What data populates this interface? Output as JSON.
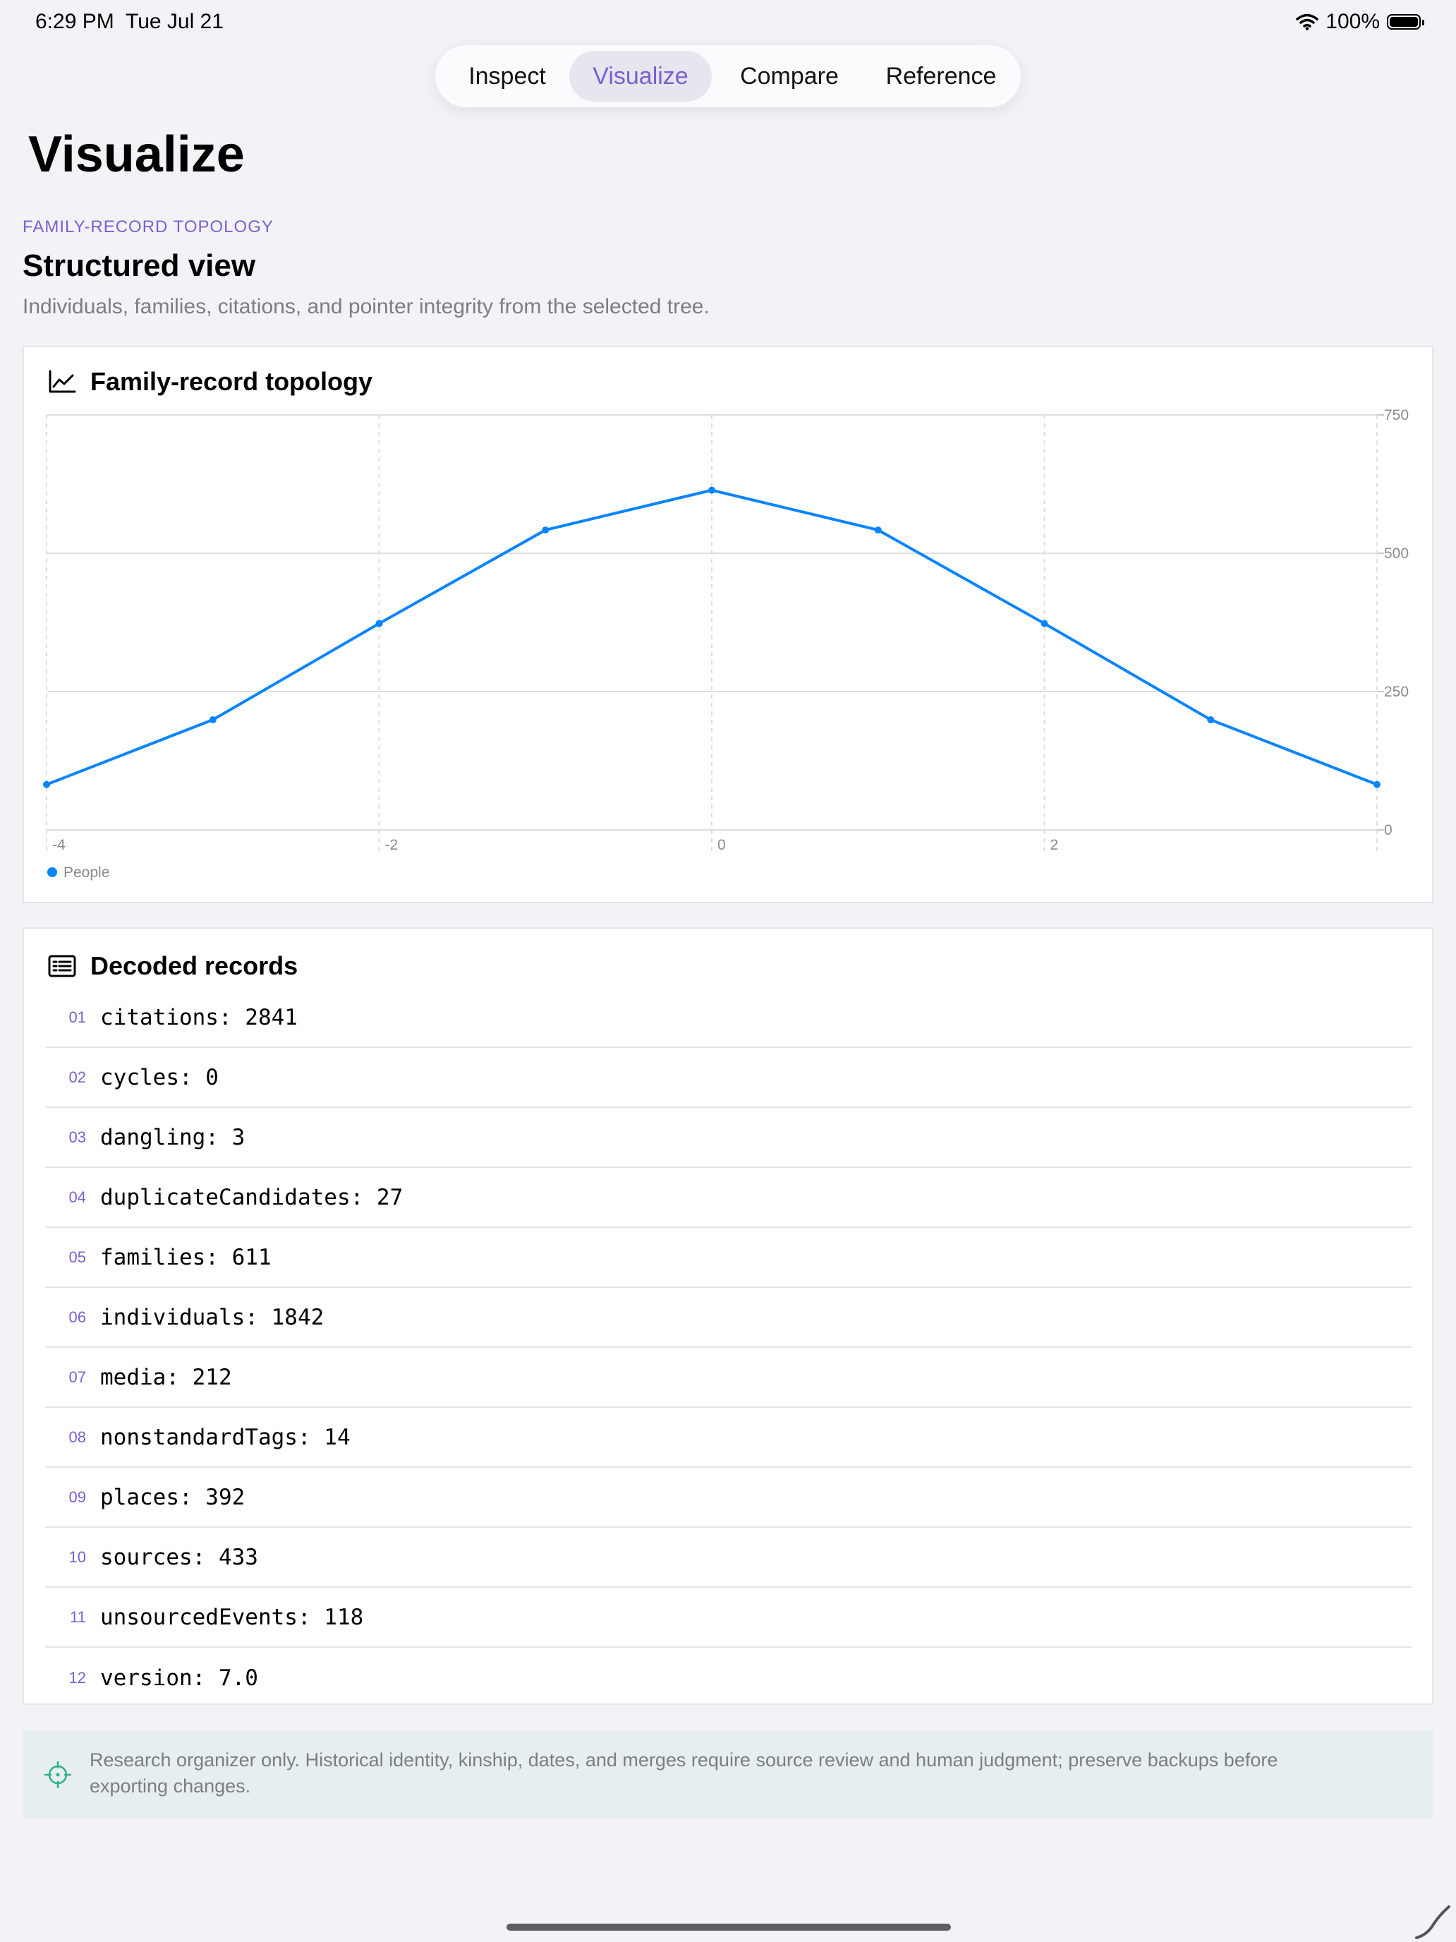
{
  "status_bar": {
    "time": "6:29 PM",
    "date": "Tue Jul 21",
    "battery": "100%",
    "battery_level": 1.0
  },
  "tabs": [
    {
      "label": "Inspect",
      "active": false
    },
    {
      "label": "Visualize",
      "active": true
    },
    {
      "label": "Compare",
      "active": false
    },
    {
      "label": "Reference",
      "active": false
    }
  ],
  "page": {
    "title": "Visualize"
  },
  "section": {
    "eyebrow": "FAMILY-RECORD TOPOLOGY",
    "title": "Structured view",
    "subtitle": "Individuals, families, citations, and pointer integrity from the selected tree."
  },
  "chart_card": {
    "title": "Family-record topology",
    "icon": "line-chart-icon"
  },
  "chart_data": {
    "type": "line",
    "x": [
      -4,
      -3,
      -2,
      -1,
      0,
      1,
      2,
      3,
      4
    ],
    "series": [
      {
        "name": "People",
        "color": "#0a84ff",
        "values": [
          82,
          199,
          373,
          542,
          614,
          542,
          373,
          199,
          82
        ]
      }
    ],
    "xlim": [
      -4,
      4
    ],
    "ylim": [
      0,
      750
    ],
    "x_ticks": [
      -4,
      -2,
      0,
      2
    ],
    "y_ticks": [
      0,
      250,
      500,
      750
    ],
    "y_axis_side": "right",
    "grid": true,
    "legend": "bottom-left",
    "title": "",
    "xlabel": "",
    "ylabel": ""
  },
  "records_card": {
    "title": "Decoded records",
    "icon": "list-icon",
    "items": [
      {
        "num": "01",
        "text": "citations: 2841"
      },
      {
        "num": "02",
        "text": "cycles: 0"
      },
      {
        "num": "03",
        "text": "dangling: 3"
      },
      {
        "num": "04",
        "text": "duplicateCandidates: 27"
      },
      {
        "num": "05",
        "text": "families: 611"
      },
      {
        "num": "06",
        "text": "individuals: 1842"
      },
      {
        "num": "07",
        "text": "media: 212"
      },
      {
        "num": "08",
        "text": "nonstandardTags: 14"
      },
      {
        "num": "09",
        "text": "places: 392"
      },
      {
        "num": "10",
        "text": "sources: 433"
      },
      {
        "num": "11",
        "text": "unsourcedEvents: 118"
      },
      {
        "num": "12",
        "text": "version: 7.0"
      }
    ]
  },
  "disclaimer": {
    "icon": "crosshair-icon",
    "text": "Research organizer only. Historical identity, kinship, dates, and merges require source review and human judgment; preserve backups before exporting changes."
  },
  "colors": {
    "accent": "#7b5fd0",
    "series": "#0a84ff",
    "background": "#f2f2f7"
  }
}
